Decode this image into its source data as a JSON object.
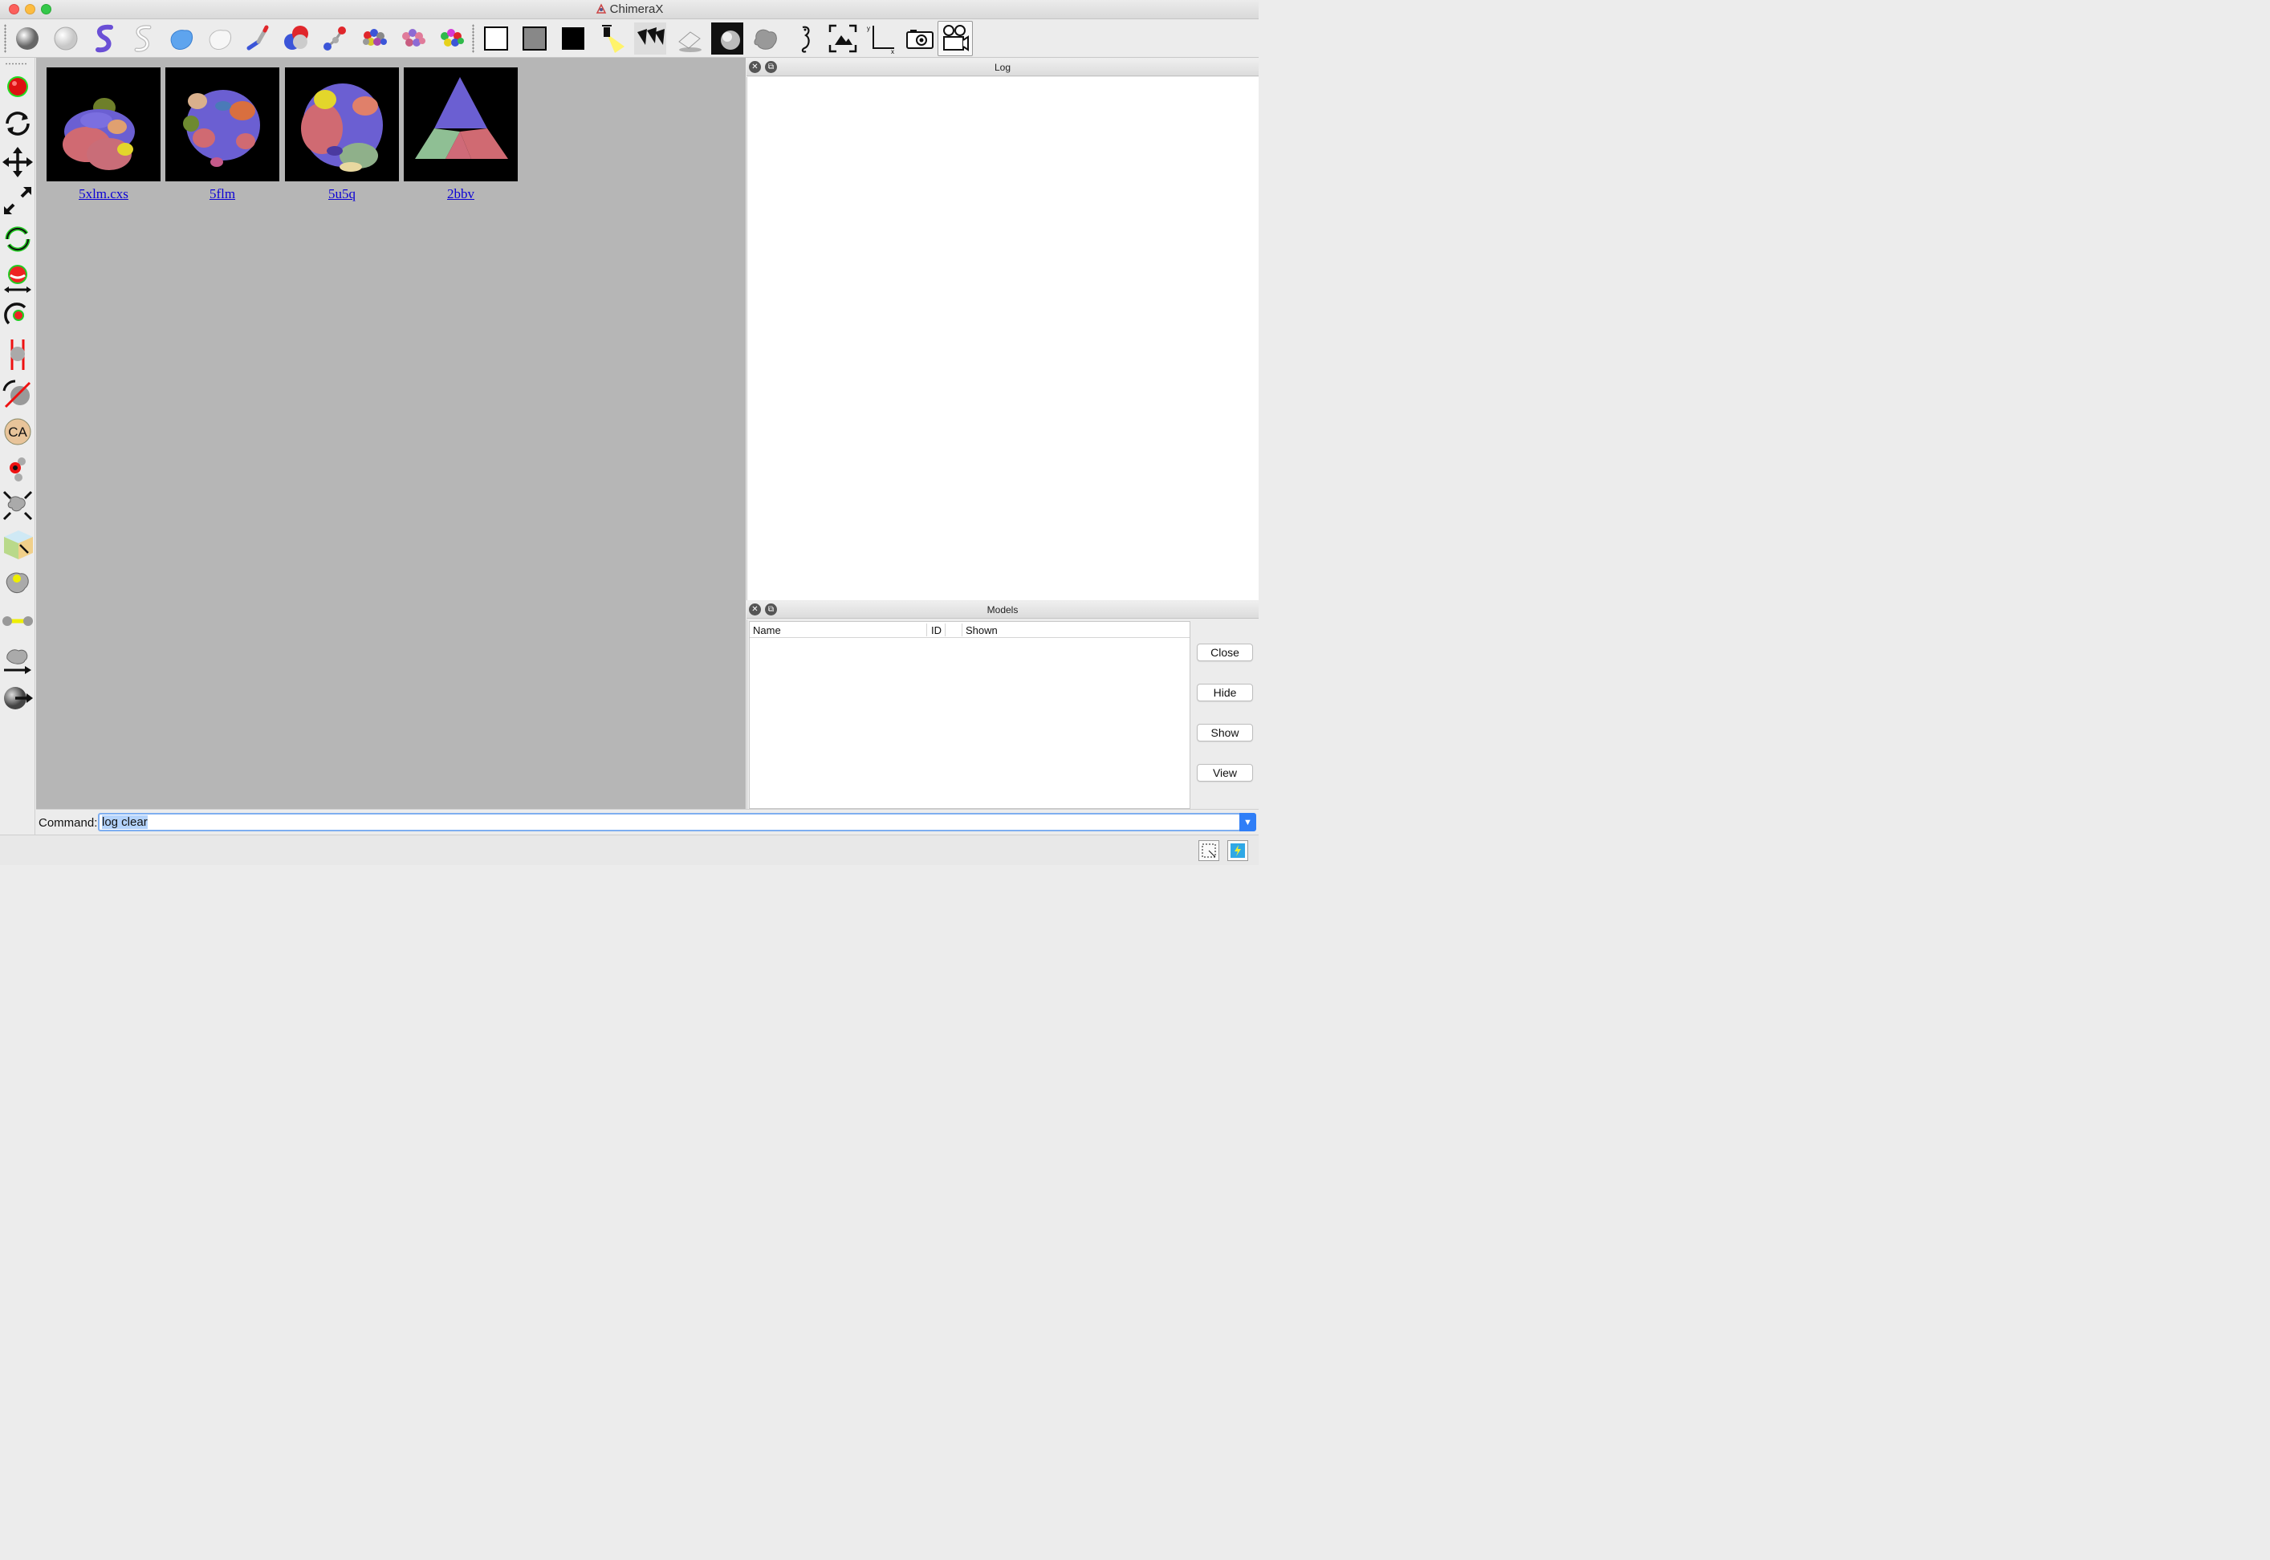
{
  "window": {
    "title": "ChimeraX"
  },
  "toolbar": {
    "icons": [
      "sphere-gray-icon",
      "sphere-white-icon",
      "ribbon-purple-icon",
      "ribbon-outline-icon",
      "surface-blue-icon",
      "surface-white-icon",
      "stick-icon",
      "ball-atom-icon",
      "ball-and-stick-icon",
      "atoms-colored-icon",
      "atoms-pink-icon",
      "atoms-rainbow-icon",
      "white-background-icon",
      "gray-background-icon",
      "black-background-icon",
      "simple-lighting-icon",
      "soft-lighting-icon",
      "full-lighting-icon",
      "flat-lighting-icon",
      "shadows-lighting-icon",
      "volume-blob-icon",
      "seahorse-icon",
      "view-all-icon",
      "axes-icon",
      "camera-icon",
      "movie-icon"
    ]
  },
  "left_toolbar": {
    "icons": [
      "select-icon",
      "rotate-icon",
      "translate-icon",
      "zoom-icon",
      "rotate-selected-icon",
      "translate-atom-icon",
      "rotate-atom-icon",
      "clip-icon",
      "clip-rotate-icon",
      "label-ca-icon",
      "pick-blob-icon",
      "move-picked-icon",
      "crop-box-icon",
      "mark-surface-icon",
      "bond-icon",
      "move-planes-icon",
      "pivot-icon"
    ],
    "label_ca": "CA"
  },
  "graphics": {
    "thumbnails": [
      {
        "label": "5xlm.cxs"
      },
      {
        "label": "5flm"
      },
      {
        "label": "5u5q"
      },
      {
        "label": "2bbv"
      }
    ]
  },
  "log_panel": {
    "title": "Log"
  },
  "models_panel": {
    "title": "Models",
    "columns": [
      "Name",
      "ID",
      "Shown"
    ],
    "buttons": {
      "close": "Close",
      "hide": "Hide",
      "show": "Show",
      "view": "View"
    }
  },
  "command": {
    "label": "Command:",
    "value": "log clear"
  },
  "colors": {
    "link": "#0b00d6",
    "graphics_bg": "#b6b6b6",
    "accent": "#2f7ef7"
  }
}
